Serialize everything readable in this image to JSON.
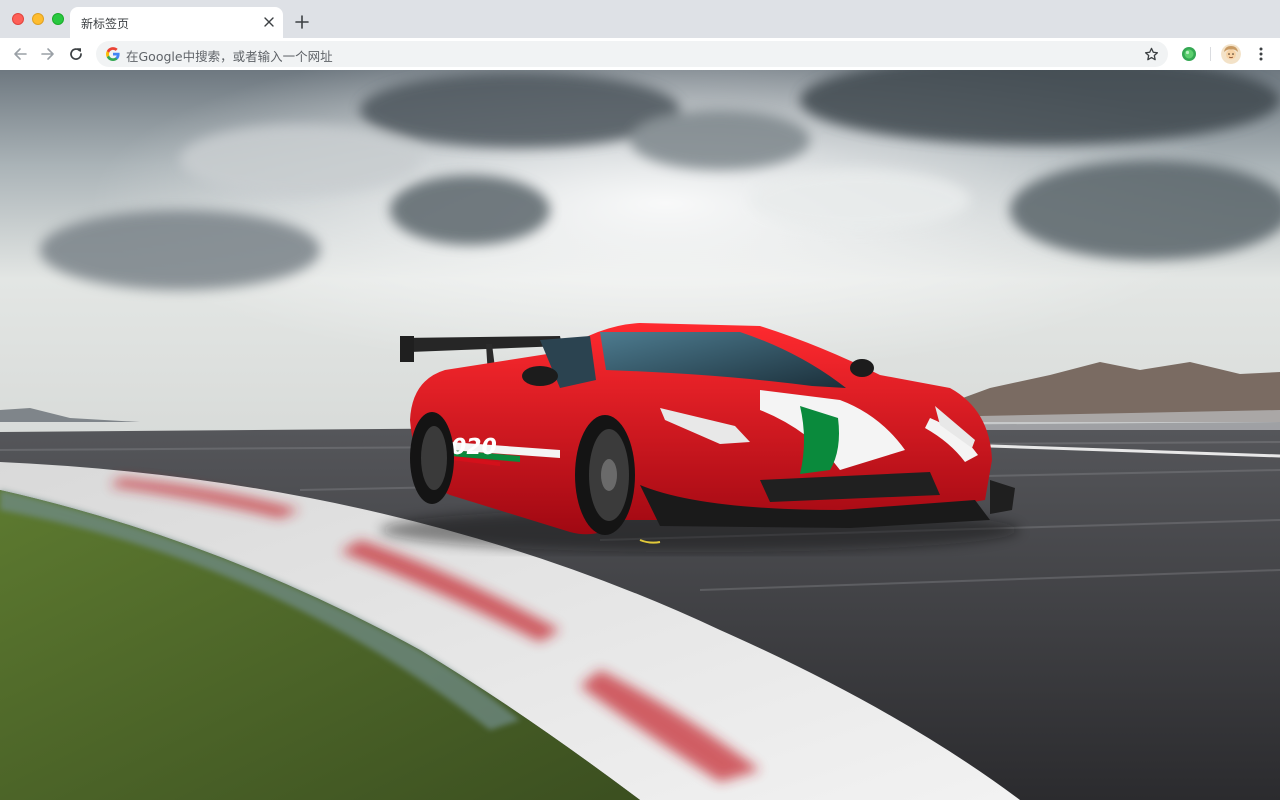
{
  "window": {
    "traffic_lights": [
      "close",
      "minimize",
      "maximize"
    ]
  },
  "tabs": [
    {
      "title": "新标签页",
      "active": true,
      "close_icon": "close-icon"
    }
  ],
  "new_tab_icon": "plus-icon",
  "toolbar": {
    "back_icon": "arrow-left-icon",
    "forward_icon": "arrow-right-icon",
    "reload_icon": "reload-icon",
    "bookmark_icon": "star-icon",
    "extension_icon": "extension-icon",
    "profile_icon": "avatar",
    "menu_icon": "kebab-menu-icon"
  },
  "omnibox": {
    "placeholder": "在Google中搜索，或者输入一个网址",
    "engine_icon": "google-icon"
  },
  "colors": {
    "tabstrip_bg": "#dee1e6",
    "omnibox_bg": "#f1f3f4",
    "car_red": "#d4101b",
    "stripe_green": "#0a8a3c",
    "sky": "#c9d0d2",
    "track": "#3b3b3d",
    "grass": "#4f6a2a"
  },
  "wallpaper": {
    "subject": "red race car on track",
    "car_number": "2020"
  }
}
